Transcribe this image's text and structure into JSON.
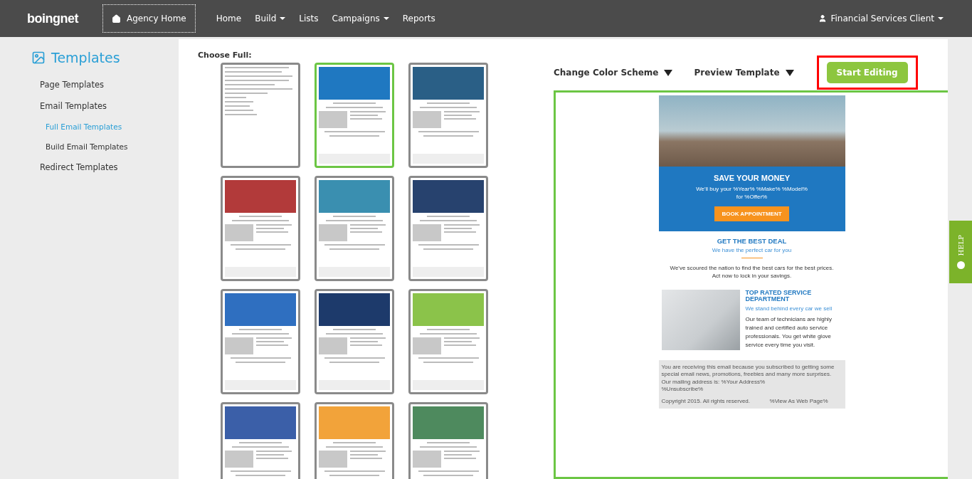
{
  "navbar": {
    "logo": "boingnet",
    "agency_button": "Agency Home",
    "links": [
      {
        "label": "Home",
        "dropdown": false
      },
      {
        "label": "Build",
        "dropdown": true
      },
      {
        "label": "Lists",
        "dropdown": false
      },
      {
        "label": "Campaigns",
        "dropdown": true
      },
      {
        "label": "Reports",
        "dropdown": false
      }
    ],
    "user": "Financial Services Client"
  },
  "sidebar": {
    "title": "Templates",
    "items": [
      {
        "label": "Page Templates",
        "selected": false
      },
      {
        "label": "Email Templates",
        "selected": false,
        "children": [
          {
            "label": "Full Email Templates",
            "selected": true
          },
          {
            "label": "Build Email Templates",
            "selected": false
          }
        ]
      },
      {
        "label": "Redirect Templates",
        "selected": false
      }
    ]
  },
  "gallery": {
    "heading": "Choose Full:",
    "thumbnails": [
      {
        "kind": "letter",
        "selected": false
      },
      {
        "kind": "email",
        "selected": true,
        "color": "#1f78c1"
      },
      {
        "kind": "email",
        "selected": false,
        "color": "#2a5f86"
      },
      {
        "kind": "email",
        "selected": false,
        "color": "#b23a3a"
      },
      {
        "kind": "email",
        "selected": false,
        "color": "#3a8fb0"
      },
      {
        "kind": "email",
        "selected": false,
        "color": "#27426e"
      },
      {
        "kind": "email",
        "selected": false,
        "color": "#2f6fc0"
      },
      {
        "kind": "email",
        "selected": false,
        "color": "#1d3a6b"
      },
      {
        "kind": "email",
        "selected": false,
        "color": "#8bc34a"
      },
      {
        "kind": "email",
        "selected": false,
        "color": "#3b5fa8"
      },
      {
        "kind": "email",
        "selected": false,
        "color": "#f2a33a"
      },
      {
        "kind": "email",
        "selected": false,
        "color": "#4e8a5e"
      }
    ]
  },
  "toolbar": {
    "menus": [
      "Change Color Scheme",
      "Preview Template"
    ],
    "start_button": "Start Editing"
  },
  "preview": {
    "hero_title": "SAVE YOUR MONEY",
    "hero_text": "We'll buy your %Year% %Make% %Model% for %Offer%",
    "hero_button": "BOOK APPOINTMENT",
    "deal_title": "GET THE BEST DEAL",
    "deal_subtitle": "We have the perfect car for you",
    "deal_text": "We've scoured the nation to find the best cars for the best prices. Act now to lock in your savings.",
    "service_title": "TOP RATED SERVICE DEPARTMENT",
    "service_subtitle": "We stand behind every car we sell",
    "service_text": "Our team of technicians are highly trained and certified auto service professionals. You get white glove service every time you visit.",
    "footer_lines": [
      "You are receiving this email because you subscribed to getting some special email news, promotions, freebies and many more surprises.",
      "Our mailing address is: %Your Address%",
      "%Unsubscribe%"
    ],
    "copyright": "Copyright 2015. All rights reserved.",
    "web_link": "%View As Web Page%"
  },
  "help_tab": "HELP"
}
